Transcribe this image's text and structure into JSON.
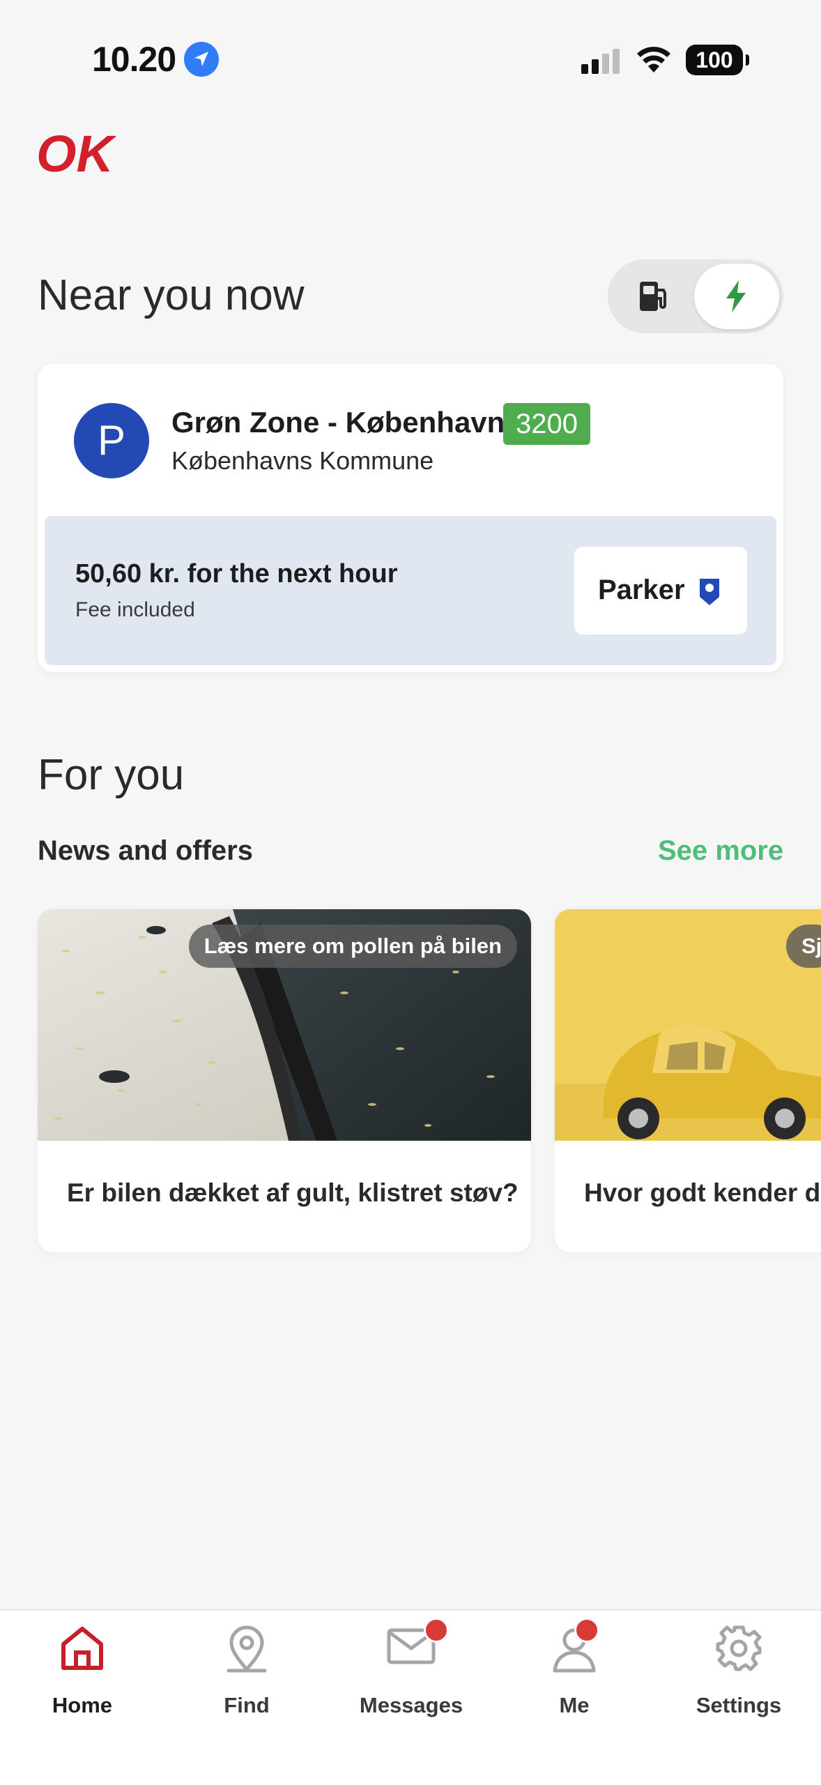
{
  "status_bar": {
    "time": "10.20",
    "battery": "100"
  },
  "brand": {
    "logo_text": "OK",
    "color": "#d3202a"
  },
  "near": {
    "title": "Near you now",
    "toggle": {
      "options": [
        "fuel-pump-icon",
        "lightning-icon"
      ],
      "selected": "lightning-icon"
    },
    "card": {
      "avatar_letter": "P",
      "zone_name": "Grøn Zone - København",
      "zone_code": "3200",
      "zone_code_color": "#4fad4d",
      "municipality": "Københavns Kommune",
      "price": "50,60 kr. for the next hour",
      "fee_note": "Fee included",
      "button_label": "Parker"
    }
  },
  "for_you": {
    "title": "For you",
    "news_label": "News and offers",
    "see_more": "See more",
    "cards": [
      {
        "tag": "Læs mere om pollen på bilen",
        "caption": "Er bilen dækket af gult, klistret støv?"
      },
      {
        "tag": "Sj",
        "caption": "Hvor godt kender du"
      }
    ]
  },
  "tabbar": {
    "items": [
      {
        "label": "Home",
        "icon": "home-icon",
        "active": true
      },
      {
        "label": "Find",
        "icon": "map-pin-icon"
      },
      {
        "label": "Messages",
        "icon": "envelope-icon",
        "badge": true
      },
      {
        "label": "Me",
        "icon": "person-icon",
        "badge": true
      },
      {
        "label": "Settings",
        "icon": "gear-icon"
      }
    ]
  },
  "colors": {
    "accent_green": "#4fbe7a",
    "park_blue": "#2349b5",
    "active_tab": "#c4202a",
    "badge": "#d93a36"
  }
}
